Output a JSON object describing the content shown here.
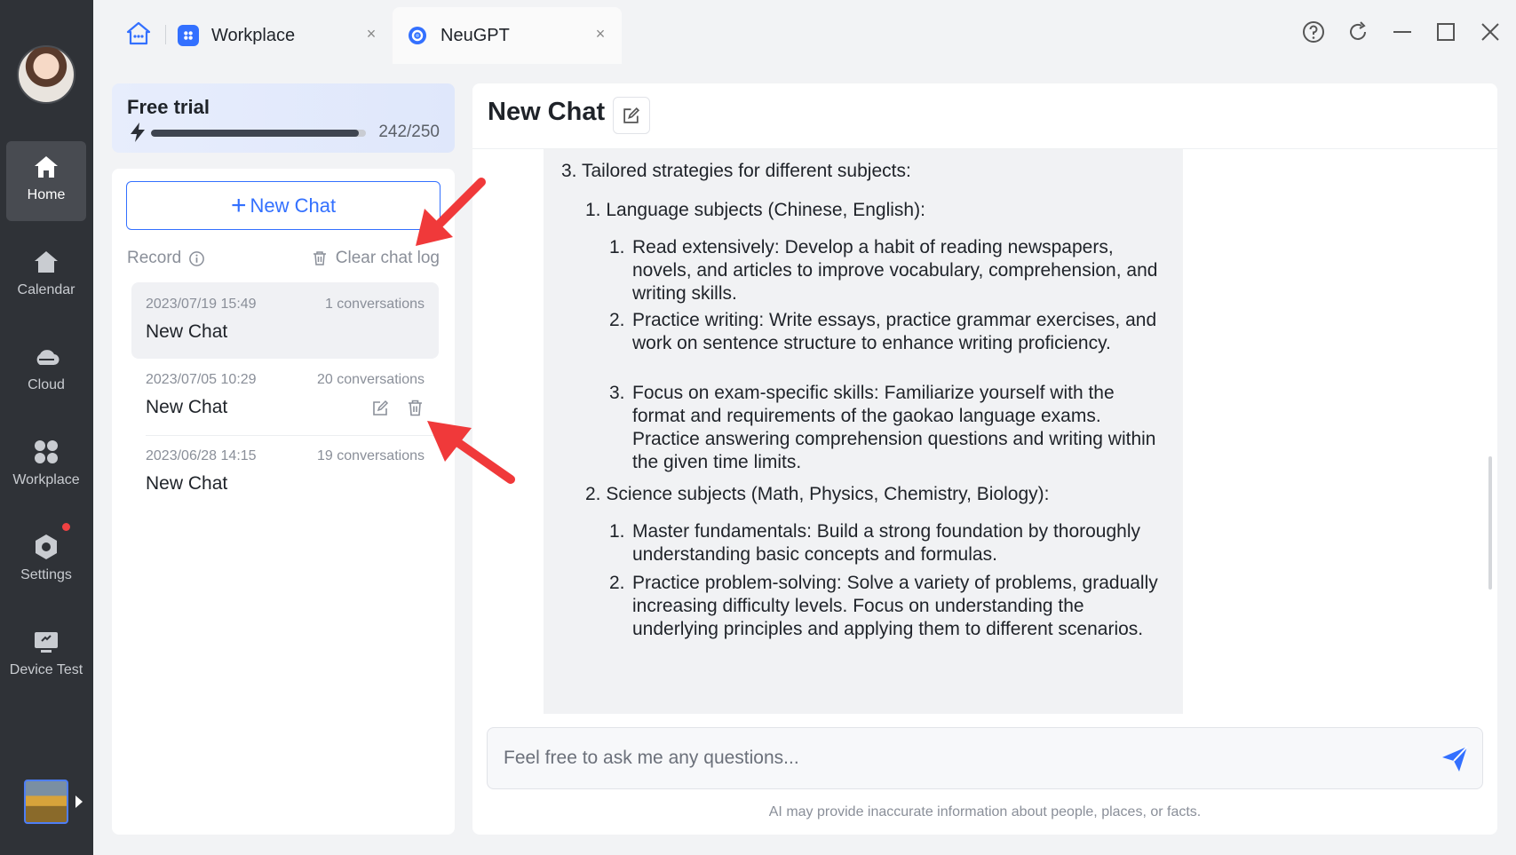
{
  "rail": {
    "items": [
      {
        "label": "Home",
        "icon": "home-icon"
      },
      {
        "label": "Calendar",
        "icon": "calendar-home-icon"
      },
      {
        "label": "Cloud",
        "icon": "cloud-icon"
      },
      {
        "label": "Workplace",
        "icon": "grid-icon"
      },
      {
        "label": "Settings",
        "icon": "settings-icon"
      },
      {
        "label": "Device Test",
        "icon": "monitor-icon"
      }
    ],
    "active": "Home",
    "settings_has_notification": true
  },
  "tabs": {
    "items": [
      {
        "label": "Workplace",
        "close": "×",
        "icon": "workplace-logo-icon"
      },
      {
        "label": "NeuGPT",
        "close": "×",
        "icon": "neugpt-logo-icon"
      }
    ],
    "active": "NeuGPT"
  },
  "sidebar": {
    "trial": {
      "title": "Free trial",
      "used": 242,
      "total": 250,
      "count_text": "242/250",
      "progress": 0.968
    },
    "new_chat_label": "New Chat",
    "new_chat_plus": "+",
    "record_label": "Record",
    "clear_log_label": "Clear chat log",
    "chats": [
      {
        "date": "2023/07/19 15:49",
        "count": "1 conversations",
        "title": "New Chat",
        "selected": true
      },
      {
        "date": "2023/07/05 10:29",
        "count": "20 conversations",
        "title": "New Chat",
        "selected": false
      },
      {
        "date": "2023/06/28 14:15",
        "count": "19 conversations",
        "title": "New Chat",
        "selected": false
      }
    ]
  },
  "main": {
    "title": "New Chat",
    "message": {
      "l1_num": "3.",
      "l1_text": "Tailored strategies for different subjects:",
      "a_num": "1.",
      "a_text": "Language subjects (Chinese, English):",
      "a1_num": "1.",
      "a1_text": "Read extensively: Develop a habit of reading newspapers, novels, and articles to improve vocabulary, comprehension, and writing skills.",
      "a2_num": "2.",
      "a2_text": "Practice writing: Write essays, practice grammar exercises, and work on sentence structure to enhance writing proficiency.",
      "a3_num": "3.",
      "a3_text": "Focus on exam-specific skills: Familiarize yourself with the format and requirements of the gaokao language exams. Practice answering comprehension questions and writing within the given time limits.",
      "b_num": "2.",
      "b_text": "Science subjects (Math, Physics, Chemistry, Biology):",
      "b1_num": "1.",
      "b1_text": "Master fundamentals: Build a strong foundation by thoroughly understanding basic concepts and formulas.",
      "b2_num": "2.",
      "b2_text": "Practice problem-solving: Solve a variety of problems, gradually increasing difficulty levels. Focus on understanding the underlying principles and applying them to different scenarios."
    },
    "input_placeholder": "Feel free to ask me any questions...",
    "disclaimer": "AI may provide inaccurate information about people, places, or facts."
  },
  "colors": {
    "accent": "#3370ff",
    "rail_bg": "#2f3237",
    "annotation_arrow": "#f0393a"
  }
}
